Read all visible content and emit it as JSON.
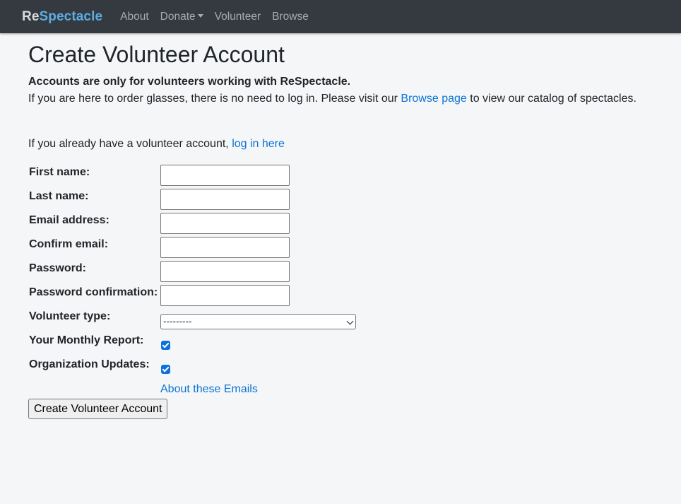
{
  "navbar": {
    "brand_re": "Re",
    "brand_spec": "Spectacle",
    "links": [
      "About",
      "Donate",
      "Volunteer",
      "Browse"
    ]
  },
  "page": {
    "title": "Create Volunteer Account",
    "note_bold": "Accounts are only for volunteers working with ReSpectacle.",
    "note_before": "If you are here to order glasses, there is no need to log in. Please visit our ",
    "note_link": "Browse page",
    "note_after": " to view our catalog of spectacles.",
    "login_text": "If you already have a volunteer account, ",
    "login_link": "log in here"
  },
  "form": {
    "first_name_label": "First name:",
    "first_name_value": "",
    "last_name_label": "Last name:",
    "last_name_value": "",
    "email_label": "Email address:",
    "email_value": "",
    "confirm_email_label": "Confirm email:",
    "confirm_email_value": "",
    "password_label": "Password:",
    "password_value": "",
    "password_confirm_label": "Password confirmation:",
    "password_confirm_value": "",
    "volunteer_type_label": "Volunteer type:",
    "volunteer_type_selected": "---------",
    "monthly_report_label": "Your Monthly Report:",
    "monthly_report_checked": true,
    "org_updates_label": "Organization Updates:",
    "org_updates_checked": true,
    "about_emails_link": "About these Emails",
    "submit_label": "Create Volunteer Account"
  },
  "colors": {
    "navbar_bg": "#343a40",
    "brand_accent": "#5dade2",
    "link": "#0a74d6",
    "page_bg": "#f5f6f8",
    "checkbox": "#0b71e0"
  }
}
